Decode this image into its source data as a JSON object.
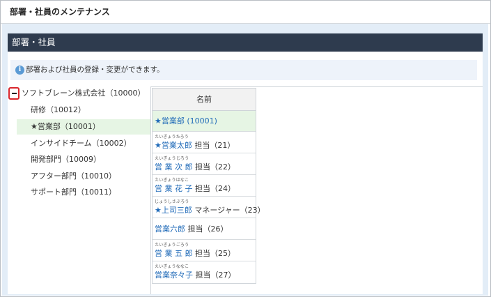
{
  "page": {
    "title": "部署・社員のメンテナンス"
  },
  "panel": {
    "title": "部署・社員"
  },
  "info": {
    "icon": "info-icon",
    "message": "部署および社員の登録・変更ができます。"
  },
  "tree": {
    "root": {
      "label": "ソフトブレーン株式会社（10000）",
      "toggle_icon": "minus-icon"
    },
    "items": [
      {
        "label": "研修（10012）",
        "selected": false
      },
      {
        "label": "★営業部（10001）",
        "selected": true
      },
      {
        "label": "インサイドチーム（10002）",
        "selected": false
      },
      {
        "label": "開発部門（10009）",
        "selected": false
      },
      {
        "label": "アフター部門（10010）",
        "selected": false
      },
      {
        "label": "サポート部門（10011）",
        "selected": false
      }
    ]
  },
  "table": {
    "header": "名前",
    "department": "★営業部 (10001)",
    "members": [
      {
        "ruby": "えいぎょうたろう",
        "name": "★営業太郎",
        "role": "担当（21）"
      },
      {
        "ruby": "えいぎょうじろう",
        "name": "営 業 次 郎",
        "role": "担当（22）"
      },
      {
        "ruby": "えいぎょうはなこ",
        "name": "営 業 花 子",
        "role": "担当（24）"
      },
      {
        "ruby": "じょうしさぶろう",
        "name": "★上司三郎",
        "role": "マネージャー（23）"
      },
      {
        "ruby": "",
        "name": "営業六郎",
        "role": "担当（26）"
      },
      {
        "ruby": "えいぎょうごろう",
        "name": "営 業 五 郎",
        "role": "担当（25）"
      },
      {
        "ruby": "えいぎょうななこ",
        "name": "営業奈々子",
        "role": "担当（27）"
      }
    ]
  },
  "colors": {
    "header_bg": "#2e3b4e",
    "selected_bg": "#e6f5e4",
    "link": "#1f6ab8",
    "toggle_border": "#d9262c",
    "info_bg": "#eef3fa"
  }
}
